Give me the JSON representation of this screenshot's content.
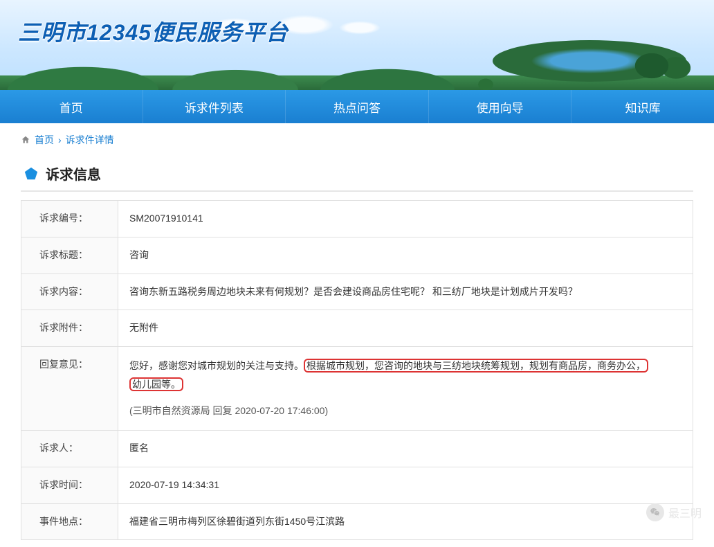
{
  "site_title": "三明市12345便民服务平台",
  "nav": [
    "首页",
    "诉求件列表",
    "热点问答",
    "使用向导",
    "知识库"
  ],
  "breadcrumb": {
    "home": "首页",
    "current": "诉求件详情"
  },
  "section_title": "诉求信息",
  "labels": {
    "id": "诉求编号：",
    "title": "诉求标题：",
    "content": "诉求内容：",
    "attachment": "诉求附件：",
    "reply": "回复意见：",
    "person": "诉求人：",
    "time": "诉求时间：",
    "location": "事件地点："
  },
  "values": {
    "id": "SM20071910141",
    "title": "咨询",
    "content": "咨询东新五路税务周边地块未来有何规划？是否会建设商品房住宅呢？ 和三纺厂地块是计划成片开发吗？",
    "attachment": "无附件",
    "reply_head": "您好，感谢您对城市规划的关注与支持。",
    "reply_hl1": "根据城市规划，您咨询的地块与三纺地块统筹规划，规划有商品房，商务办公，",
    "reply_hl2": "幼儿园等。",
    "reply_meta": "(三明市自然资源局 回复 2020-07-20 17:46:00)",
    "person": "匿名",
    "time": "2020-07-19 14:34:31",
    "location": "福建省三明市梅列区徐碧街道列东街1450号江滨路"
  },
  "watermark": "最三明"
}
